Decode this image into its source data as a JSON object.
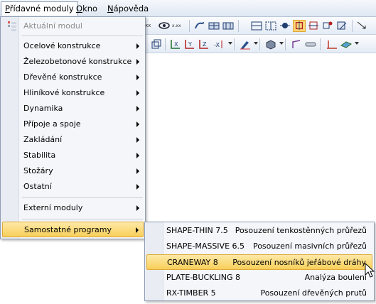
{
  "menubar": {
    "items": [
      {
        "label": "Přídavné moduly",
        "active": true
      },
      {
        "label": "Okno"
      },
      {
        "label": "Nápověda"
      }
    ]
  },
  "toolbar": {
    "icons": [
      "xx-icon",
      "eye-icon",
      "xxx-icon",
      "tool-icon",
      "grid-icon",
      "grid2-icon",
      "member-icon",
      "grid3-icon",
      "node-icon",
      "support-icon",
      "support-active-icon",
      "hinge-icon",
      "load-icon",
      "arrow-icon",
      "cube-icon",
      "axis-x-icon",
      "axis-y-icon",
      "axis-z-icon",
      "axis-neg-x-icon",
      "pen-icon",
      "box-icon",
      "bar-icon",
      "spring-icon",
      "beam-icon",
      "surface-icon"
    ]
  },
  "menu": {
    "header": "Aktuální modul",
    "items": [
      {
        "label": "Ocelové konstrukce",
        "submenu": true
      },
      {
        "label": "Železobetonové konstrukce",
        "submenu": true
      },
      {
        "label": "Dřevěné konstrukce",
        "submenu": true
      },
      {
        "label": "Hliníkové konstrukce",
        "submenu": true
      },
      {
        "label": "Dynamika",
        "submenu": true
      },
      {
        "label": "Přípoje a spoje",
        "submenu": true
      },
      {
        "label": "Zakládání",
        "submenu": true
      },
      {
        "label": "Stabilita",
        "submenu": true
      },
      {
        "label": "Stožáry",
        "submenu": true
      },
      {
        "label": "Ostatní",
        "submenu": true
      }
    ],
    "external": "Externí moduly",
    "standalone": "Samostatné programy"
  },
  "submenu": {
    "items": [
      {
        "name": "SHAPE-THIN 7.5",
        "desc": "Posouzení tenkostěnných průřezů"
      },
      {
        "name": "SHAPE-MASSIVE 6.5",
        "desc": "Posouzení masivních průřezů"
      },
      {
        "name": "CRANEWAY 8",
        "desc": "Posouzení nosníků jeřábové dráhy",
        "selected": true
      },
      {
        "name": "PLATE-BUCKLING 8",
        "desc": "Analýza boulení"
      },
      {
        "name": "RX-TIMBER 5",
        "desc": "Posouzení dřevěných prutů"
      }
    ]
  },
  "colors": {
    "highlight": "#f8cf5a",
    "menu_bg": "#f4f6f9",
    "border": "#8f9db3"
  }
}
